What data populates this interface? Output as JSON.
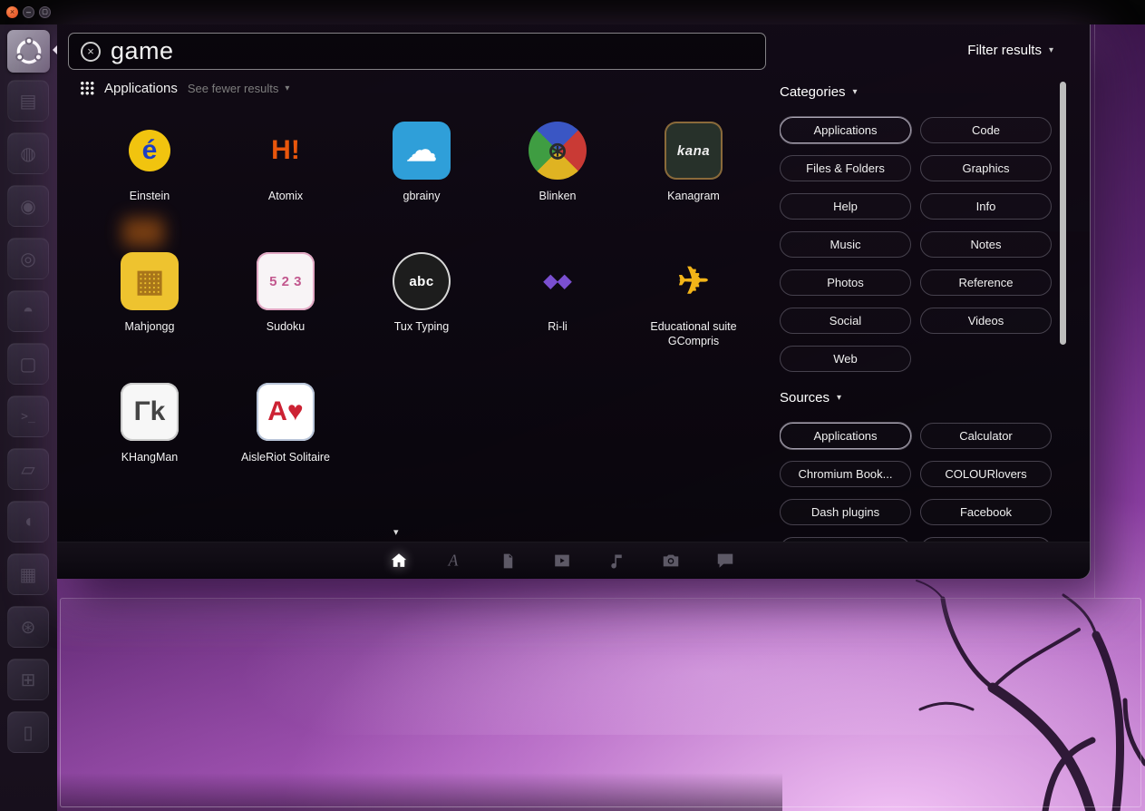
{
  "top_bar": {
    "controls": [
      {
        "name": "close",
        "glyph": "×"
      },
      {
        "name": "minimize",
        "glyph": "–"
      },
      {
        "name": "maximize",
        "glyph": "▢"
      }
    ]
  },
  "launcher": {
    "items": [
      {
        "name": "files",
        "glyph": "▤"
      },
      {
        "name": "browser",
        "glyph": "◍"
      },
      {
        "name": "media-player",
        "glyph": "◉"
      },
      {
        "name": "music-player",
        "glyph": "◎"
      },
      {
        "name": "voice-chat",
        "glyph": "◓"
      },
      {
        "name": "games",
        "glyph": "▢"
      },
      {
        "name": "terminal",
        "glyph": ">_"
      },
      {
        "name": "text-editor",
        "glyph": "▱"
      },
      {
        "name": "messenger",
        "glyph": "◖"
      },
      {
        "name": "spreadsheet",
        "glyph": "▦"
      },
      {
        "name": "system-settings",
        "glyph": "⊛"
      },
      {
        "name": "workspace-switcher",
        "glyph": "⊞"
      },
      {
        "name": "trash",
        "glyph": "▯"
      }
    ]
  },
  "dash": {
    "search": {
      "value": "game",
      "filter_label": "Filter results"
    },
    "section": {
      "title": "Applications",
      "toggle_label": "See fewer results"
    },
    "apps": [
      {
        "name": "Einstein",
        "icon": {
          "shape": "circle",
          "bg": "#f1c40f",
          "fg": "#1d3fc4",
          "glyph": "é",
          "size": 46
        }
      },
      {
        "name": "Atomix",
        "icon": {
          "shape": "none",
          "bg": "transparent",
          "fg": "#e8560c",
          "glyph": "H!"
        }
      },
      {
        "name": "gbrainy",
        "icon": {
          "shape": "rounded",
          "bg": "#2f9fd9",
          "fg": "#ffffff",
          "glyph": "☁",
          "glyph_size": 34
        }
      },
      {
        "name": "Blinken",
        "icon": {
          "shape": "circle",
          "bg": "conic",
          "fg": "#2a2a2a",
          "glyph": "⊛",
          "glyph_size": 26
        }
      },
      {
        "name": "Kanagram",
        "icon": {
          "shape": "rounded",
          "bg": "#27312a",
          "fg": "#efefef",
          "glyph": "kana",
          "border": "#8a6a3a",
          "italic": true
        }
      },
      {
        "name": "Mahjongg",
        "icon": {
          "shape": "rounded",
          "bg": "#eec32f",
          "fg": "#a8751a",
          "glyph": "▦",
          "glyph_size": 34
        }
      },
      {
        "name": "Sudoku",
        "icon": {
          "shape": "rounded",
          "bg": "#f8f4f6",
          "fg": "#c2578e",
          "glyph": "5 2 3",
          "border": "#e2a8c4"
        }
      },
      {
        "name": "Tux Typing",
        "icon": {
          "shape": "circle",
          "bg": "#1d1d1d",
          "fg": "#ffffff",
          "glyph": "abc",
          "border": "#d8d8d8"
        }
      },
      {
        "name": "Ri-li",
        "icon": {
          "shape": "none",
          "bg": "transparent",
          "fg": "#7a4fd0",
          "glyph": "◆◆",
          "glyph_size": 20
        }
      },
      {
        "name": "Educational suite GCompris",
        "icon": {
          "shape": "none",
          "bg": "transparent",
          "fg": "#f2b418",
          "glyph": "✈",
          "glyph_size": 42
        }
      },
      {
        "name": "KHangMan",
        "icon": {
          "shape": "rounded",
          "bg": "#f7f7f7",
          "fg": "#444444",
          "glyph": "Γk",
          "border": "#cccccc"
        }
      },
      {
        "name": "AisleRiot Solitaire",
        "icon": {
          "shape": "rounded",
          "bg": "#ffffff",
          "fg": "#cc2233",
          "glyph": "A♥",
          "border": "#b8c4d8"
        }
      }
    ],
    "categories": {
      "title": "Categories",
      "items": [
        {
          "label": "Applications",
          "selected": true
        },
        {
          "label": "Code"
        },
        {
          "label": "Files & Folders"
        },
        {
          "label": "Graphics"
        },
        {
          "label": "Help"
        },
        {
          "label": "Info"
        },
        {
          "label": "Music"
        },
        {
          "label": "Notes"
        },
        {
          "label": "Photos"
        },
        {
          "label": "Reference"
        },
        {
          "label": "Social"
        },
        {
          "label": "Videos"
        },
        {
          "label": "Web"
        }
      ]
    },
    "sources": {
      "title": "Sources",
      "items": [
        {
          "label": "Applications",
          "selected": true
        },
        {
          "label": "Calculator"
        },
        {
          "label": "Chromium Book..."
        },
        {
          "label": "COLOURlovers"
        },
        {
          "label": "Dash plugins"
        },
        {
          "label": "Facebook"
        }
      ]
    },
    "lenses": [
      {
        "name": "home",
        "active": true
      },
      {
        "name": "applications",
        "active": false
      },
      {
        "name": "files",
        "active": false
      },
      {
        "name": "videos",
        "active": false
      },
      {
        "name": "music",
        "active": false
      },
      {
        "name": "photos",
        "active": false
      },
      {
        "name": "social",
        "active": false
      }
    ]
  },
  "colors": {
    "dash_background": "#0d0913",
    "selected_border": "#a9a4b2",
    "wallpaper_accent": "#8d3fa4",
    "search_text": "#f2f2f2",
    "button_text": "#f0f0f0",
    "dim_text": "#7d7d7d"
  }
}
